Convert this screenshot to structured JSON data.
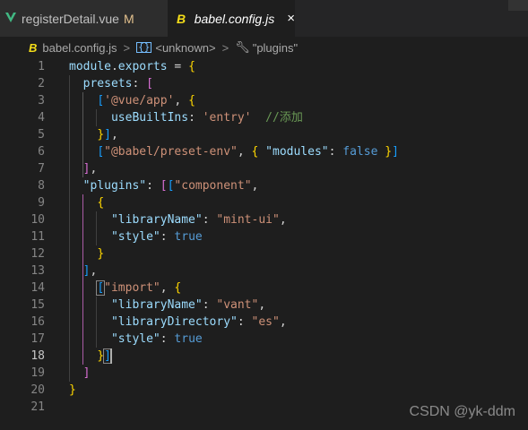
{
  "tabs": [
    {
      "label": "registerDetail.vue",
      "badge": "M",
      "icon": "vue-icon"
    },
    {
      "label": "babel.config.js",
      "icon": "babel-icon",
      "close": "×"
    }
  ],
  "breadcrumb": {
    "file": "babel.config.js",
    "icon": "B",
    "sep1": ">",
    "symbol1": "<unknown>",
    "sep2": ">",
    "symbol2": "\"plugins\""
  },
  "editor": {
    "active_line": 18,
    "lines": [
      "module.exports = {",
      "  presets: [",
      "    ['@vue/app', {",
      "      useBuiltIns: 'entry'  //添加",
      "    }],",
      "    [\"@babel/preset-env\", { \"modules\": false }]",
      "  ],",
      "  \"plugins\": [[\"component\",",
      "    {",
      "      \"libraryName\": \"mint-ui\",",
      "      \"style\": true",
      "    }",
      "  ],",
      "    [\"import\", {",
      "      \"libraryName\": \"vant\",",
      "      \"libraryDirectory\": \"es\",",
      "      \"style\": true",
      "    }]",
      "  ]",
      "}",
      ""
    ]
  },
  "watermark": "CSDN @yk-ddm"
}
